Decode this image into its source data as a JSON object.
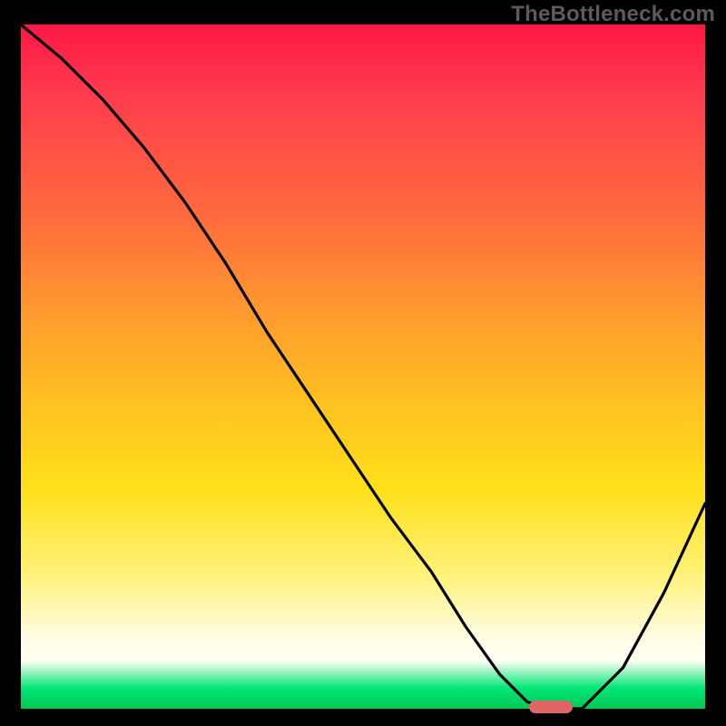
{
  "watermark": "TheBottleneck.com",
  "chart_data": {
    "type": "line",
    "title": "",
    "xlabel": "",
    "ylabel": "",
    "xlim": [
      0,
      1
    ],
    "ylim": [
      0,
      1
    ],
    "series": [
      {
        "name": "curve",
        "x": [
          0.0,
          0.06,
          0.12,
          0.18,
          0.24,
          0.3,
          0.36,
          0.42,
          0.48,
          0.54,
          0.6,
          0.65,
          0.7,
          0.74,
          0.78,
          0.82,
          0.88,
          0.94,
          1.0
        ],
        "y": [
          1.0,
          0.95,
          0.89,
          0.82,
          0.74,
          0.65,
          0.55,
          0.46,
          0.37,
          0.28,
          0.2,
          0.12,
          0.05,
          0.01,
          0.0,
          0.0,
          0.06,
          0.17,
          0.3
        ]
      }
    ],
    "marker": {
      "x": 0.775,
      "y": 0.0,
      "width_frac": 0.064
    },
    "gradient_stops": [
      {
        "pos": 0.0,
        "color": "#ff1744"
      },
      {
        "pos": 0.1,
        "color": "#ff3b4e"
      },
      {
        "pos": 0.28,
        "color": "#ff6b3d"
      },
      {
        "pos": 0.42,
        "color": "#ff9a2e"
      },
      {
        "pos": 0.55,
        "color": "#ffc021"
      },
      {
        "pos": 0.68,
        "color": "#ffe11a"
      },
      {
        "pos": 0.8,
        "color": "#fff176"
      },
      {
        "pos": 0.9,
        "color": "#fffde7"
      },
      {
        "pos": 0.93,
        "color": "#fffef2"
      },
      {
        "pos": 0.97,
        "color": "#00e676"
      },
      {
        "pos": 1.0,
        "color": "#00c853"
      }
    ]
  }
}
